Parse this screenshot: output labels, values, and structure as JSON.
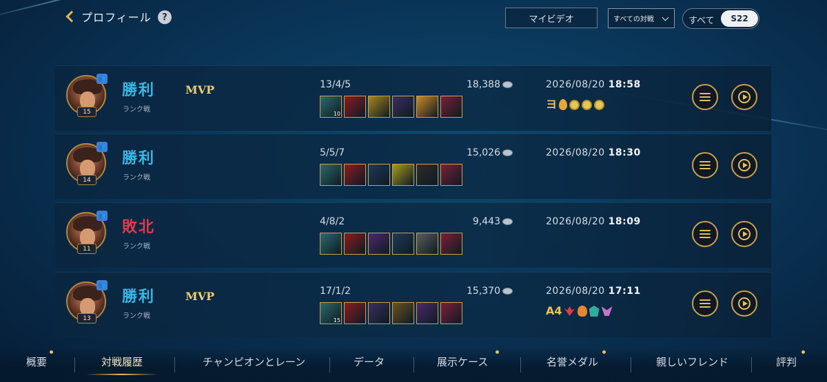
{
  "header": {
    "title": "プロフィール",
    "help": "?",
    "my_video": "マイビデオ",
    "filter_selected": "すべての対戦",
    "season_all": "すべて",
    "season_current": "S22"
  },
  "matches": [
    {
      "result": "勝利",
      "result_type": "win",
      "mode": "ランク戦",
      "level": "15",
      "mvp": "MVP",
      "kda": "13/4/5",
      "gold": "18,388",
      "item_stack": "10",
      "date": "2026/08/20",
      "time": "18:58",
      "badge_text": "ヨ",
      "badges": [
        "drop-icon",
        "coin-icon",
        "coin-icon",
        "coin-icon"
      ]
    },
    {
      "result": "勝利",
      "result_type": "win",
      "mode": "ランク戦",
      "level": "14",
      "mvp": "",
      "kda": "5/5/7",
      "gold": "15,026",
      "item_stack": "",
      "date": "2026/08/20",
      "time": "18:30",
      "badge_text": "",
      "badges": []
    },
    {
      "result": "敗北",
      "result_type": "lose",
      "mode": "ランク戦",
      "level": "11",
      "mvp": "",
      "kda": "4/8/2",
      "gold": "9,443",
      "item_stack": "",
      "date": "2026/08/20",
      "time": "18:09",
      "badge_text": "",
      "badges": []
    },
    {
      "result": "勝利",
      "result_type": "win",
      "mode": "ランク戦",
      "level": "13",
      "mvp": "MVP",
      "kda": "17/1/2",
      "gold": "15,370",
      "item_stack": "15",
      "date": "2026/08/20",
      "time": "17:11",
      "badge_text": "A4",
      "badges": [
        "red-icon",
        "flame-icon",
        "crest-icon",
        "wing-icon"
      ]
    }
  ],
  "nav": {
    "items": [
      "概要",
      "対戦履歴",
      "チャンピオンとレーン",
      "データ",
      "展示ケース",
      "名誉メダル",
      "親しいフレンド",
      "評判"
    ]
  },
  "colors": {
    "win": "#3ab6e6",
    "lose": "#e2394a",
    "gold_accent": "#c9a34d"
  }
}
